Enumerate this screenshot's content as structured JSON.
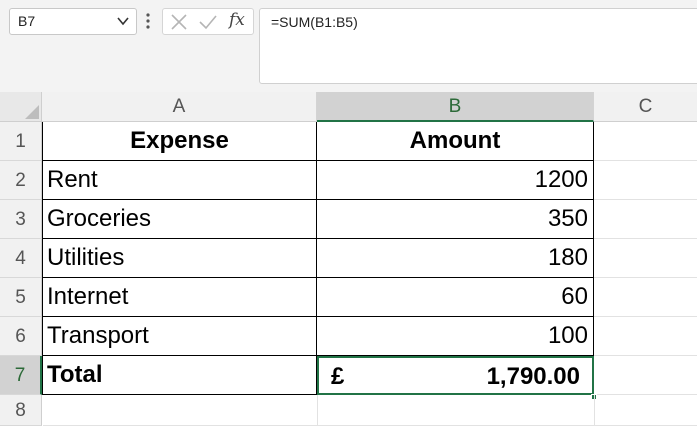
{
  "formula_bar": {
    "name_box": "B7",
    "fx_label": "fx",
    "formula": "=SUM(B1:B5)"
  },
  "columns": [
    "A",
    "B",
    "C"
  ],
  "rows": [
    "1",
    "2",
    "3",
    "4",
    "5",
    "6",
    "7",
    "8"
  ],
  "cells": {
    "A1": "Expense",
    "B1": "Amount",
    "A2": "Rent",
    "B2": "1200",
    "A3": "Groceries",
    "B3": "350",
    "A4": "Utilities",
    "B4": "180",
    "A5": "Internet",
    "B5": "60",
    "A6": "Transport",
    "B6": "100",
    "A7": "Total",
    "B7_currency": "£",
    "B7_amount": "1,790.00"
  },
  "selection": {
    "active_cell": "B7",
    "active_column": "B",
    "active_row": "7"
  },
  "colors": {
    "accent": "#217346",
    "header_bg": "#f1f1f1",
    "selected_header_bg": "#d2d2d2"
  },
  "icons": [
    "chevron-down-icon",
    "more-options-icon",
    "cancel-icon",
    "enter-icon",
    "insert-function-icon",
    "select-all-icon"
  ]
}
